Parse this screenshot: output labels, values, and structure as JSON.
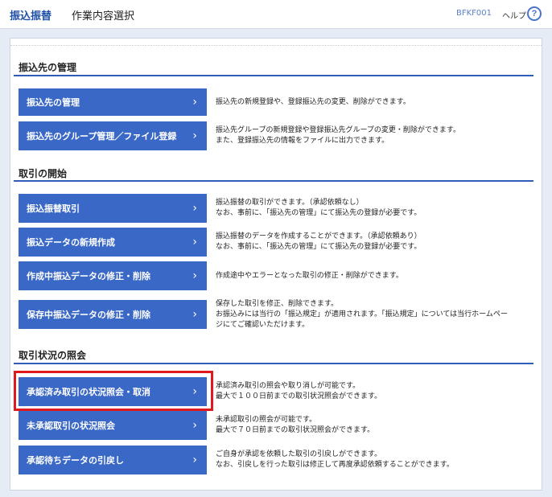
{
  "header": {
    "title": "振込振替",
    "subtitle": "作業内容選択",
    "screen_id": "BFKF001",
    "help_label": "ヘルプ",
    "help_icon": "?"
  },
  "sections": [
    {
      "title": "振込先の管理",
      "items": [
        {
          "label": "振込先の管理",
          "chevron": "›",
          "desc": "振込先の新規登録や、登録振込先の変更、削除ができます。"
        },
        {
          "label": "振込先のグループ管理／ファイル登録",
          "chevron": "›",
          "desc": "振込先グループの新規登録や登録振込先グループの変更・削除ができます。\nまた、登録振込先の情報をファイルに出力できます。"
        }
      ]
    },
    {
      "title": "取引の開始",
      "items": [
        {
          "label": "振込振替取引",
          "chevron": "›",
          "desc": "振込振替の取引ができます。（承認依頼なし）\nなお、事前に、「振込先の管理」にて振込先の登録が必要です。"
        },
        {
          "label": "振込データの新規作成",
          "chevron": "›",
          "desc": "振込振替のデータを作成することができます。（承認依頼あり）\nなお、事前に、「振込先の管理」にて振込先の登録が必要です。"
        },
        {
          "label": "作成中振込データの修正・削除",
          "chevron": "›",
          "desc": "作成途中やエラーとなった取引の修正・削除ができます。"
        },
        {
          "label": "保存中振込データの修正・削除",
          "chevron": "›",
          "desc": "保存した取引を修正、削除できます。\nお振込みには当行の「振込規定」が適用されます。「振込規定」については当行ホームペー\nジにてご確認いただけます。"
        }
      ]
    },
    {
      "title": "取引状況の照会",
      "items": [
        {
          "label": "承認済み取引の状況照会・取消",
          "chevron": "›",
          "desc": "承認済み取引の照会や取り消しが可能です。\n最大で１００日前までの取引状況照会ができます。"
        },
        {
          "label": "未承認取引の状況照会",
          "chevron": "›",
          "desc": "未承認取引の照会が可能です。\n最大で７０日前までの取引状況照会ができます。"
        },
        {
          "label": "承認待ちデータの引戻し",
          "chevron": "›",
          "desc": "ご自身が承認を依頼した取引の引戻しができます。\nなお、引戻しを行った取引は修正して再度承認依頼することができます。"
        }
      ]
    }
  ],
  "colors": {
    "button": "#3a68c6",
    "accent": "#2e5cb8",
    "highlight": "#e0191e"
  }
}
